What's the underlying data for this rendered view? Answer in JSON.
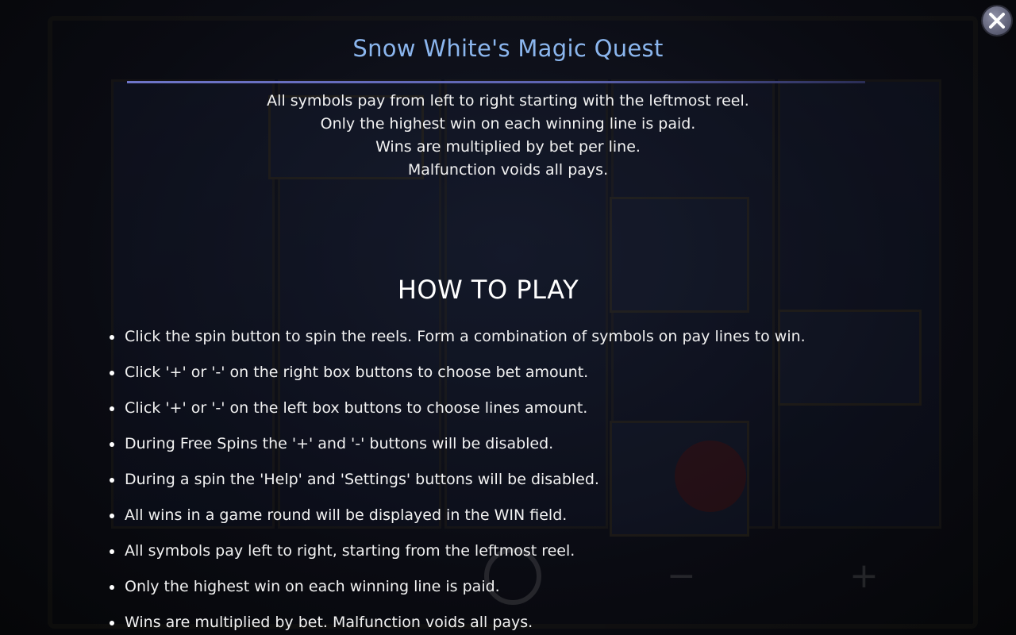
{
  "game_title": "Snow White's Magic Quest",
  "intro_lines": [
    "All symbols pay from left to right starting with the leftmost reel.",
    "Only the highest win on each winning line is paid.",
    "Wins are multiplied by bet per line.",
    "Malfunction voids all pays."
  ],
  "how_to_play": {
    "heading": "HOW TO PLAY",
    "rules": [
      "Click the spin button to spin the reels. Form a combination of symbols on pay lines to win.",
      "Click '+' or '-' on the right box buttons to choose bet amount.",
      "Click '+' or '-' on the left box buttons to choose lines amount.",
      "During Free Spins the '+' and '-' buttons will be disabled.",
      "During a spin the 'Help' and 'Settings' buttons will be disabled.",
      "All wins in a game round will be displayed in the WIN field.",
      "All symbols pay left to right, starting from the leftmost reel.",
      "Only the highest win on each winning line is paid.",
      "Wins are multiplied by bet. Malfunction voids all pays."
    ]
  },
  "icons": {
    "close": "close-icon"
  },
  "colors": {
    "title": "#8bb6ee",
    "rule": "#6e75c8",
    "text": "#f2f2f2",
    "background": "#07080c"
  }
}
